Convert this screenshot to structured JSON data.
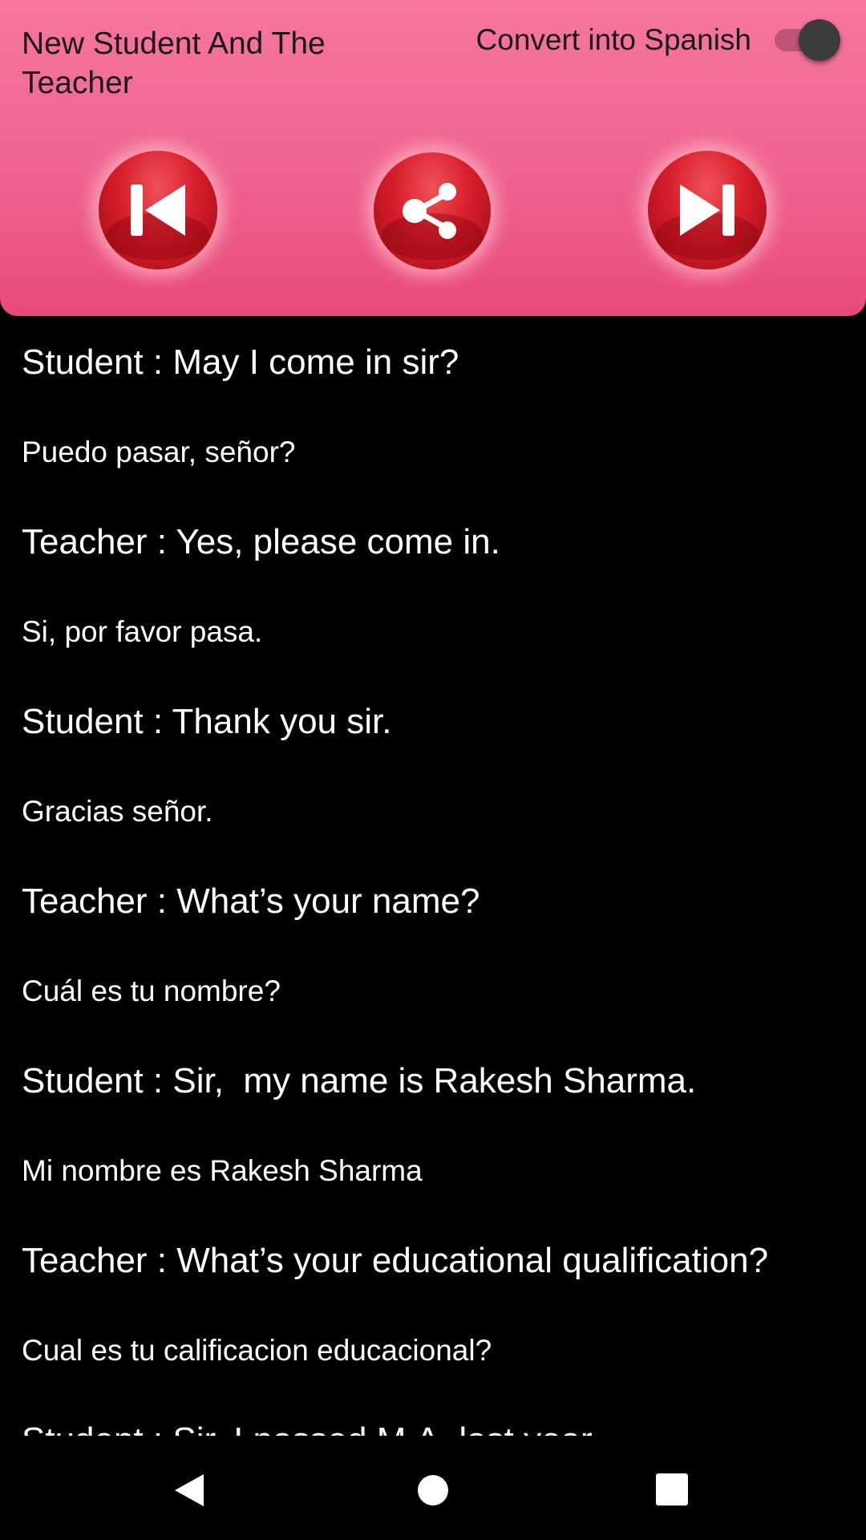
{
  "header": {
    "title": "New Student And The Teacher",
    "toggle_label": "Convert into Spanish",
    "toggle_on": true,
    "accent_color": "#ef6390",
    "buttons": [
      {
        "name": "previous",
        "icon": "skip-previous-icon"
      },
      {
        "name": "share",
        "icon": "share-icon"
      },
      {
        "name": "next",
        "icon": "skip-next-icon"
      }
    ]
  },
  "dialogue": [
    {
      "english": "Student : May I come in sir?",
      "spanish": "Puedo pasar, señor?"
    },
    {
      "english": "Teacher : Yes, please come in.",
      "spanish": "Si, por favor pasa."
    },
    {
      "english": "Student : Thank you sir.",
      "spanish": "Gracias señor."
    },
    {
      "english": "Teacher : What’s your name?",
      "spanish": "Cuál es tu nombre?"
    },
    {
      "english": "Student : Sir,  my name is Rakesh Sharma.",
      "spanish": "Mi nombre es Rakesh Sharma"
    },
    {
      "english": "Teacher : What’s your educational qualification?",
      "spanish": "Cual es tu calificacion educacional?"
    },
    {
      "english": "Student : Sir, I passed M.A. last year.",
      "spanish": ""
    }
  ],
  "navbar": {
    "back": "back-triangle-icon",
    "home": "home-circle-icon",
    "recents": "recents-square-icon"
  }
}
